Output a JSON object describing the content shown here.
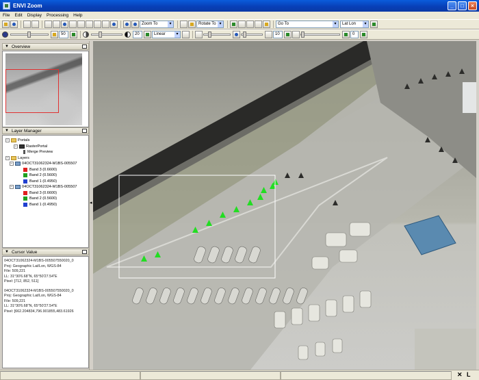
{
  "window": {
    "title": "ENVI Zoom"
  },
  "menu": [
    "File",
    "Edit",
    "Display",
    "Processing",
    "Help"
  ],
  "toolbar": {
    "zoom_label": "Zoom To",
    "rotate_label": "Rotate To",
    "goto_label": "Go To",
    "coord_label": "Lat Lon"
  },
  "toolbar2": {
    "brightness": "50",
    "contrast": "20",
    "stretch": "Linear",
    "sharpen": "10",
    "transparency": "0"
  },
  "panels": {
    "overview": "Overview",
    "layer_manager": "Layer Manager",
    "cursor_value": "Cursor Value"
  },
  "layers": {
    "portals": "Portals",
    "raster_portal": "RasterPortal",
    "merge_preview": "Merge Preview",
    "layers": "Layers",
    "layer1": "04OCT31062324-M1BS-005507",
    "layer1_bands": [
      "Band 3 (0.6600)",
      "Band 2 (0.5600)",
      "Band 1 (0.4950)"
    ],
    "layer2": "04OCT31062324-M1BS-005507",
    "layer2_bands": [
      "Band 3 (0.6600)",
      "Band 2 (0.5600)",
      "Band 1 (0.4950)"
    ]
  },
  "cursor_value": {
    "block1": [
      "04OCT31062324-M1BS-005507550020_0",
      "Proj: Geographic Lat/Lon, WGS-84",
      "File: 509,221",
      "LL: 31°30'6.68\"N, 65°50'27.54\"E",
      "Pixel: [712, 852, 511]"
    ],
    "block2": [
      "04OCT31062324-M1BS-005507550020_0",
      "Proj: Geographic Lat/Lon, WGS-84",
      "File: 509,221",
      "LL: 31°30'6.68\"N, 65°50'27.54\"E",
      "Pixel: [662.204834,796.901855,483.61926"
    ]
  },
  "status": {
    "close_glyph": "✕",
    "extra_glyph": "L"
  },
  "colors": {
    "titlebar": "#0a5cdc",
    "band_red": "#e02020",
    "band_green": "#20a020",
    "band_blue": "#2040d0",
    "overview_box": "#e03030",
    "highlight": "#22dd22"
  }
}
